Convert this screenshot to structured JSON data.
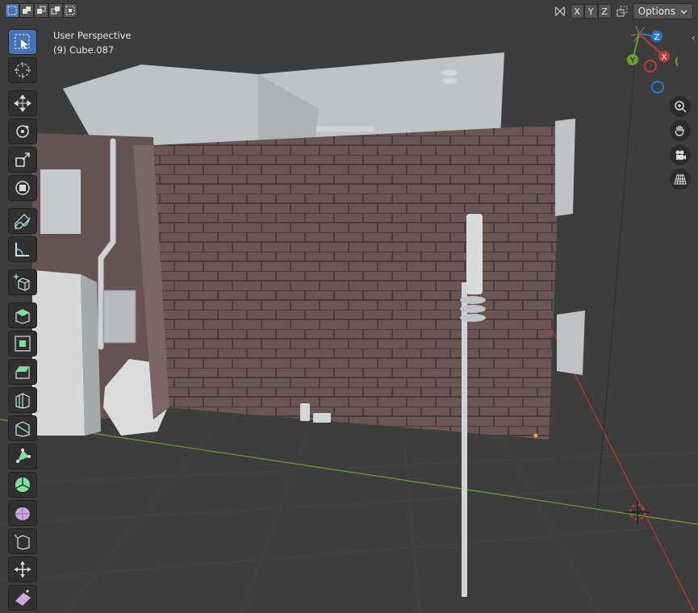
{
  "header": {
    "select_modes": [
      "select-box-icon",
      "select-extend-icon",
      "select-subtract-icon",
      "select-invert-icon",
      "select-intersect-icon"
    ],
    "mirror_axes": [
      "X",
      "Y",
      "Z"
    ],
    "options_label": "Options"
  },
  "viewport": {
    "perspective_label": "User Perspective",
    "object_label": "(9) Cube.087"
  },
  "toolbar": {
    "tools": [
      "select-box",
      "cursor",
      "move",
      "rotate",
      "scale",
      "transform",
      "annotate",
      "measure",
      "add-cube",
      "extrude-region",
      "inset-faces",
      "bevel",
      "loop-cut",
      "knife",
      "poly-build",
      "spin",
      "smooth",
      "edge-slide",
      "shrink-fatten",
      "shear"
    ]
  },
  "gizmo": {
    "z_label": "Z",
    "y_label": "Y",
    "x_label": "X"
  },
  "colors": {
    "background": "#3d3d3d",
    "accent": "#4772b3",
    "brick": "#6b5556",
    "x_axis": "#c0393b",
    "y_axis": "#6d9e2f",
    "z_axis": "#2f75c6"
  }
}
